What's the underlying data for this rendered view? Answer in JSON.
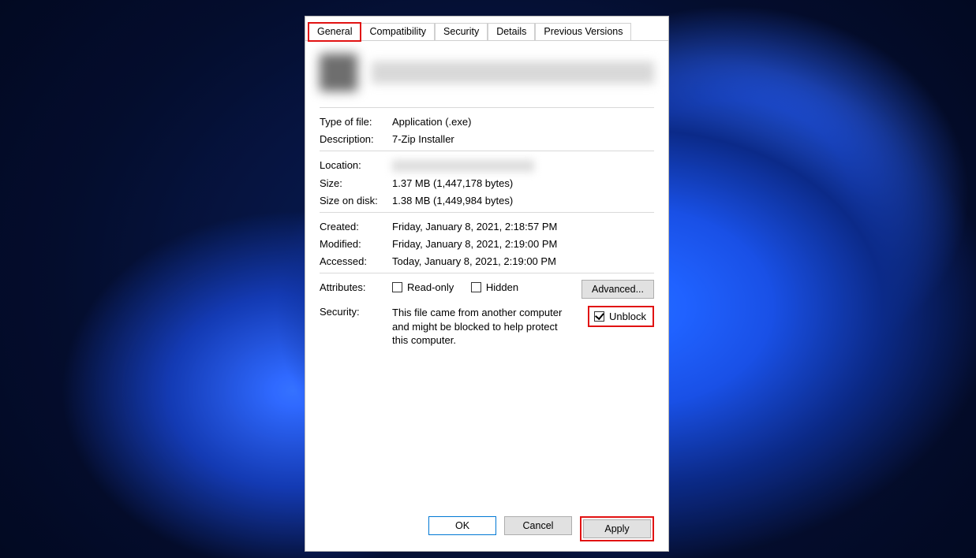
{
  "tabs": {
    "general": "General",
    "compatibility": "Compatibility",
    "security": "Security",
    "details": "Details",
    "previous": "Previous Versions"
  },
  "labels": {
    "type_of_file": "Type of file:",
    "description": "Description:",
    "location": "Location:",
    "size": "Size:",
    "size_on_disk": "Size on disk:",
    "created": "Created:",
    "modified": "Modified:",
    "accessed": "Accessed:",
    "attributes": "Attributes:",
    "security": "Security:"
  },
  "values": {
    "type_of_file": "Application (.exe)",
    "description": "7-Zip Installer",
    "size": "1.37 MB (1,447,178 bytes)",
    "size_on_disk": "1.38 MB (1,449,984 bytes)",
    "created": "Friday, January 8, 2021, 2:18:57 PM",
    "modified": "Friday, January 8, 2021, 2:19:00 PM",
    "accessed": "Today, January 8, 2021, 2:19:00 PM",
    "security_text": "This file came from another computer and might be blocked to help protect this computer."
  },
  "checkboxes": {
    "readonly": "Read-only",
    "hidden": "Hidden",
    "unblock": "Unblock"
  },
  "buttons": {
    "advanced": "Advanced...",
    "ok": "OK",
    "cancel": "Cancel",
    "apply": "Apply"
  }
}
